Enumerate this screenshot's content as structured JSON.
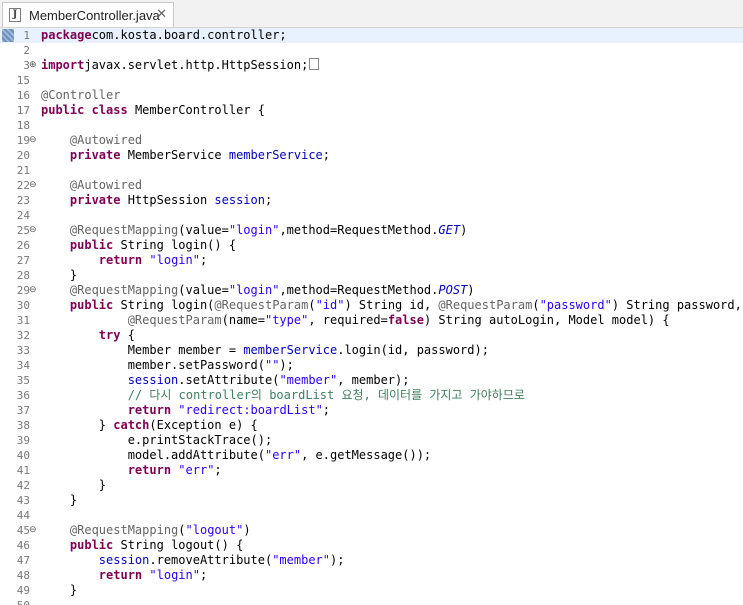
{
  "tab": {
    "title": "MemberController.java",
    "close_label": "✕",
    "icon_label": "J"
  },
  "lines": [
    {
      "n": "1",
      "hl": true,
      "marker": true,
      "fold": "",
      "segs": [
        [
          "kw",
          "package"
        ],
        [
          "",
          "com.kosta.board.controller;"
        ]
      ]
    },
    {
      "n": "2",
      "fold": "",
      "segs": []
    },
    {
      "n": "3",
      "fold": "⊕",
      "segs": [
        [
          "kw",
          "import"
        ],
        [
          "",
          "javax.servlet.http.HttpSession;"
        ],
        [
          "box",
          ""
        ]
      ]
    },
    {
      "n": "15",
      "fold": "",
      "segs": []
    },
    {
      "n": "16",
      "fold": "",
      "segs": [
        [
          "ann",
          "@Controller"
        ]
      ]
    },
    {
      "n": "17",
      "fold": "",
      "segs": [
        [
          "kw",
          "public"
        ],
        [
          "",
          " "
        ],
        [
          "kw",
          "class"
        ],
        [
          "",
          " MemberController {"
        ]
      ]
    },
    {
      "n": "18",
      "fold": "",
      "segs": []
    },
    {
      "n": "19",
      "fold": "⊖",
      "segs": [
        [
          "",
          "    "
        ],
        [
          "ann",
          "@Autowired"
        ]
      ]
    },
    {
      "n": "20",
      "fold": "",
      "segs": [
        [
          "",
          "    "
        ],
        [
          "kw",
          "private"
        ],
        [
          "",
          " MemberService "
        ],
        [
          "fld",
          "memberService"
        ],
        [
          "",
          ";"
        ]
      ]
    },
    {
      "n": "21",
      "fold": "",
      "segs": []
    },
    {
      "n": "22",
      "fold": "⊖",
      "segs": [
        [
          "",
          "    "
        ],
        [
          "ann",
          "@Autowired"
        ]
      ]
    },
    {
      "n": "23",
      "fold": "",
      "segs": [
        [
          "",
          "    "
        ],
        [
          "kw",
          "private"
        ],
        [
          "",
          " HttpSession "
        ],
        [
          "fld",
          "session"
        ],
        [
          "",
          ";"
        ]
      ]
    },
    {
      "n": "24",
      "fold": "",
      "segs": []
    },
    {
      "n": "25",
      "fold": "⊖",
      "segs": [
        [
          "",
          "    "
        ],
        [
          "ann",
          "@RequestMapping"
        ],
        [
          "",
          "(value="
        ],
        [
          "str",
          "\"login\""
        ],
        [
          "",
          ",method=RequestMethod."
        ],
        [
          "it",
          "GET"
        ],
        [
          "",
          ")"
        ]
      ]
    },
    {
      "n": "26",
      "fold": "",
      "segs": [
        [
          "",
          "    "
        ],
        [
          "kw",
          "public"
        ],
        [
          "",
          " String login() {"
        ]
      ]
    },
    {
      "n": "27",
      "fold": "",
      "segs": [
        [
          "",
          "        "
        ],
        [
          "kw",
          "return"
        ],
        [
          "",
          " "
        ],
        [
          "str",
          "\"login\""
        ],
        [
          "",
          ";"
        ]
      ]
    },
    {
      "n": "28",
      "fold": "",
      "segs": [
        [
          "",
          "    }"
        ]
      ]
    },
    {
      "n": "29",
      "fold": "⊖",
      "segs": [
        [
          "",
          "    "
        ],
        [
          "ann",
          "@RequestMapping"
        ],
        [
          "",
          "(value="
        ],
        [
          "str",
          "\"login\""
        ],
        [
          "",
          ",method=RequestMethod."
        ],
        [
          "it",
          "POST"
        ],
        [
          "",
          ")"
        ]
      ]
    },
    {
      "n": "30",
      "fold": "",
      "segs": [
        [
          "",
          "    "
        ],
        [
          "kw",
          "public"
        ],
        [
          "",
          " String login("
        ],
        [
          "ann",
          "@RequestParam"
        ],
        [
          "",
          "("
        ],
        [
          "str",
          "\"id\""
        ],
        [
          "",
          ") String id, "
        ],
        [
          "ann",
          "@RequestParam"
        ],
        [
          "",
          "("
        ],
        [
          "str",
          "\"password\""
        ],
        [
          "",
          ") String password,"
        ]
      ]
    },
    {
      "n": "31",
      "fold": "",
      "segs": [
        [
          "",
          "            "
        ],
        [
          "ann",
          "@RequestParam"
        ],
        [
          "",
          "(name="
        ],
        [
          "str",
          "\"type\""
        ],
        [
          "",
          ", required="
        ],
        [
          "kw",
          "false"
        ],
        [
          "",
          ") String autoLogin, Model model) {"
        ]
      ]
    },
    {
      "n": "32",
      "fold": "",
      "segs": [
        [
          "",
          "        "
        ],
        [
          "kw",
          "try"
        ],
        [
          "",
          " {"
        ]
      ]
    },
    {
      "n": "33",
      "fold": "",
      "segs": [
        [
          "",
          "            Member member = "
        ],
        [
          "fld",
          "memberService"
        ],
        [
          "",
          ".login(id, password);"
        ]
      ]
    },
    {
      "n": "34",
      "fold": "",
      "segs": [
        [
          "",
          "            member.setPassword("
        ],
        [
          "str",
          "\"\""
        ],
        [
          "",
          ");"
        ]
      ]
    },
    {
      "n": "35",
      "fold": "",
      "segs": [
        [
          "",
          "            "
        ],
        [
          "fld",
          "session"
        ],
        [
          "",
          ".setAttribute("
        ],
        [
          "str",
          "\"member\""
        ],
        [
          "",
          ", member);"
        ]
      ]
    },
    {
      "n": "36",
      "fold": "",
      "segs": [
        [
          "",
          "            "
        ],
        [
          "cmt",
          "// 다시 controller의 boardList 요청, 데이터를 가지고 가야하므로"
        ]
      ]
    },
    {
      "n": "37",
      "fold": "",
      "segs": [
        [
          "",
          "            "
        ],
        [
          "kw",
          "return"
        ],
        [
          "",
          " "
        ],
        [
          "str",
          "\"redirect:boardList\""
        ],
        [
          "",
          ";"
        ]
      ]
    },
    {
      "n": "38",
      "fold": "",
      "segs": [
        [
          "",
          "        } "
        ],
        [
          "kw",
          "catch"
        ],
        [
          "",
          "(Exception e) {"
        ]
      ]
    },
    {
      "n": "39",
      "fold": "",
      "segs": [
        [
          "",
          "            e.printStackTrace();"
        ]
      ]
    },
    {
      "n": "40",
      "fold": "",
      "segs": [
        [
          "",
          "            model.addAttribute("
        ],
        [
          "str",
          "\"err\""
        ],
        [
          "",
          ", e.getMessage());"
        ]
      ]
    },
    {
      "n": "41",
      "fold": "",
      "segs": [
        [
          "",
          "            "
        ],
        [
          "kw",
          "return"
        ],
        [
          "",
          " "
        ],
        [
          "str",
          "\"err\""
        ],
        [
          "",
          ";"
        ]
      ]
    },
    {
      "n": "42",
      "fold": "",
      "segs": [
        [
          "",
          "        }"
        ]
      ]
    },
    {
      "n": "43",
      "fold": "",
      "segs": [
        [
          "",
          "    }"
        ]
      ]
    },
    {
      "n": "44",
      "fold": "",
      "segs": []
    },
    {
      "n": "45",
      "fold": "⊖",
      "segs": [
        [
          "",
          "    "
        ],
        [
          "ann",
          "@RequestMapping"
        ],
        [
          "",
          "("
        ],
        [
          "str",
          "\"logout\""
        ],
        [
          "",
          ")"
        ]
      ]
    },
    {
      "n": "46",
      "fold": "",
      "segs": [
        [
          "",
          "    "
        ],
        [
          "kw",
          "public"
        ],
        [
          "",
          " String logout() {"
        ]
      ]
    },
    {
      "n": "47",
      "fold": "",
      "segs": [
        [
          "",
          "        "
        ],
        [
          "fld",
          "session"
        ],
        [
          "",
          ".removeAttribute("
        ],
        [
          "str",
          "\"member\""
        ],
        [
          "",
          ");"
        ]
      ]
    },
    {
      "n": "48",
      "fold": "",
      "segs": [
        [
          "",
          "        "
        ],
        [
          "kw",
          "return"
        ],
        [
          "",
          " "
        ],
        [
          "str",
          "\"login\""
        ],
        [
          "",
          ";"
        ]
      ]
    },
    {
      "n": "49",
      "fold": "",
      "segs": [
        [
          "",
          "    }"
        ]
      ]
    },
    {
      "n": "50",
      "fold": "",
      "segs": []
    }
  ]
}
